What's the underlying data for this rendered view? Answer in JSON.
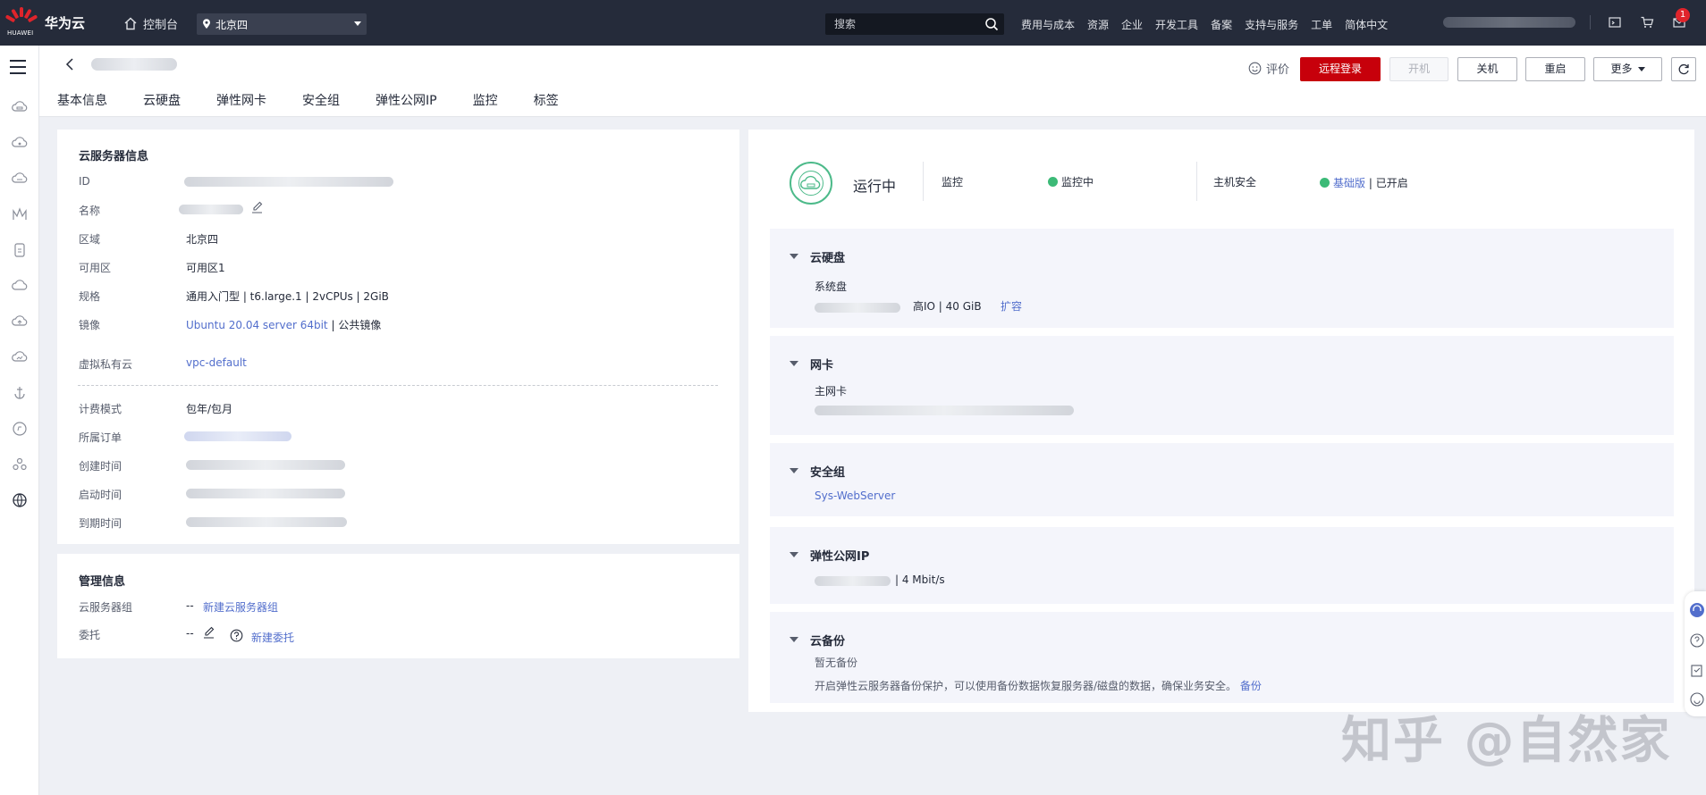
{
  "topbar": {
    "logo_text": "HUAWEI",
    "brand": "华为云",
    "console": "控制台",
    "region": "北京四",
    "search_placeholder": "搜索",
    "nav": [
      "费用与成本",
      "资源",
      "企业",
      "开发工具",
      "备案",
      "支持与服务",
      "工单",
      "简体中文"
    ],
    "notification_count": "1"
  },
  "header": {
    "rate": "评价",
    "buttons": {
      "remote_login": "远程登录",
      "start": "开机",
      "shutdown": "关机",
      "restart": "重启",
      "more": "更多"
    },
    "tabs": [
      "基本信息",
      "云硬盘",
      "弹性网卡",
      "安全组",
      "弹性公网IP",
      "监控",
      "标签"
    ]
  },
  "server_info": {
    "title": "云服务器信息",
    "fields": {
      "id_label": "ID",
      "name_label": "名称",
      "region_label": "区域",
      "region_value": "北京四",
      "az_label": "可用区",
      "az_value": "可用区1",
      "spec_label": "规格",
      "spec_value": "通用入门型 | t6.large.1 | 2vCPUs | 2GiB",
      "image_label": "镜像",
      "image_link": "Ubuntu 20.04 server 64bit",
      "image_suffix": " | 公共镜像",
      "vpc_label": "虚拟私有云",
      "vpc_value": "vpc-default",
      "billing_label": "计费模式",
      "billing_value": "包年/包月",
      "order_label": "所属订单",
      "created_label": "创建时间",
      "started_label": "启动时间",
      "expire_label": "到期时间"
    }
  },
  "management": {
    "title": "管理信息",
    "group_label": "云服务器组",
    "group_dash": "--",
    "group_link": "新建云服务器组",
    "delegate_label": "委托",
    "delegate_dash": "--",
    "delegate_link": "新建委托"
  },
  "status": {
    "state": "运行中",
    "monitor_label": "监控",
    "monitor_value": "监控中",
    "host_security_label": "主机安全",
    "host_security_link": "基础版",
    "host_security_value": "| 已开启"
  },
  "sections": {
    "disk": {
      "title": "云硬盘",
      "sub": "系统盘",
      "detail": "高IO  |  40 GiB",
      "action": "扩容"
    },
    "nic": {
      "title": "网卡",
      "sub": "主网卡"
    },
    "sg": {
      "title": "安全组",
      "value": "Sys-WebServer"
    },
    "eip": {
      "title": "弹性公网IP",
      "value": "|  4 Mbit/s"
    },
    "backup": {
      "title": "云备份",
      "sub": "暂无备份",
      "desc": "开启弹性云服务器备份保护，可以使用备份数据恢复服务器/磁盘的数据，确保业务安全。",
      "action": "备份"
    }
  },
  "watermark": "知乎 @自然家",
  "colors": {
    "topbar": "#252b3a",
    "primary": "#c7000b",
    "link": "#526ecc",
    "success": "#3cba77"
  }
}
